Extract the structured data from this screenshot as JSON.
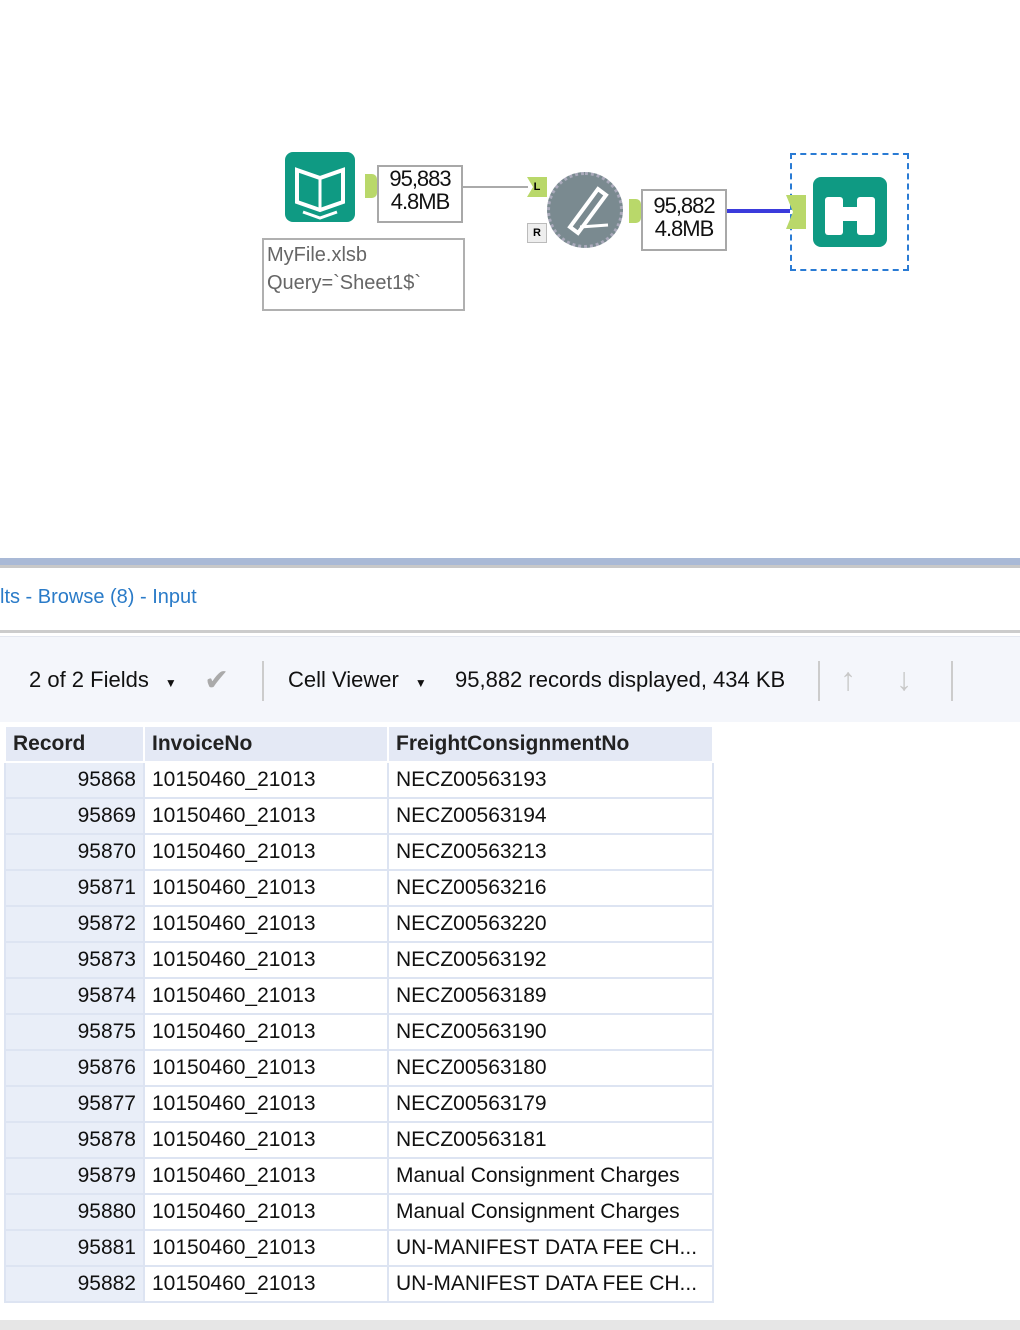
{
  "workflow": {
    "input_counts": {
      "records": "95,883",
      "size": "4.8MB"
    },
    "input_annotation": [
      "MyFile.xlsb",
      "Query=`Sheet1$`"
    ],
    "join_left_label": "L",
    "join_right_label": "R",
    "output_counts": {
      "records": "95,882",
      "size": "4.8MB"
    }
  },
  "results": {
    "title": "lts - Browse (8) - Input",
    "fields_label": "2 of 2 Fields",
    "viewer_label": "Cell Viewer",
    "status": "95,882 records displayed, 434 KB",
    "columns": [
      "Record",
      "InvoiceNo",
      "FreightConsignmentNo"
    ],
    "rows": [
      [
        "95868",
        "10150460_21013",
        "NECZ00563193"
      ],
      [
        "95869",
        "10150460_21013",
        "NECZ00563194"
      ],
      [
        "95870",
        "10150460_21013",
        "NECZ00563213"
      ],
      [
        "95871",
        "10150460_21013",
        "NECZ00563216"
      ],
      [
        "95872",
        "10150460_21013",
        "NECZ00563220"
      ],
      [
        "95873",
        "10150460_21013",
        "NECZ00563192"
      ],
      [
        "95874",
        "10150460_21013",
        "NECZ00563189"
      ],
      [
        "95875",
        "10150460_21013",
        "NECZ00563190"
      ],
      [
        "95876",
        "10150460_21013",
        "NECZ00563180"
      ],
      [
        "95877",
        "10150460_21013",
        "NECZ00563179"
      ],
      [
        "95878",
        "10150460_21013",
        "NECZ00563181"
      ],
      [
        "95879",
        "10150460_21013",
        "Manual Consignment Charges"
      ],
      [
        "95880",
        "10150460_21013",
        "Manual Consignment Charges"
      ],
      [
        "95881",
        "10150460_21013",
        "UN-MANIFEST DATA FEE CH..."
      ],
      [
        "95882",
        "10150460_21013",
        "UN-MANIFEST DATA FEE CH..."
      ]
    ]
  }
}
